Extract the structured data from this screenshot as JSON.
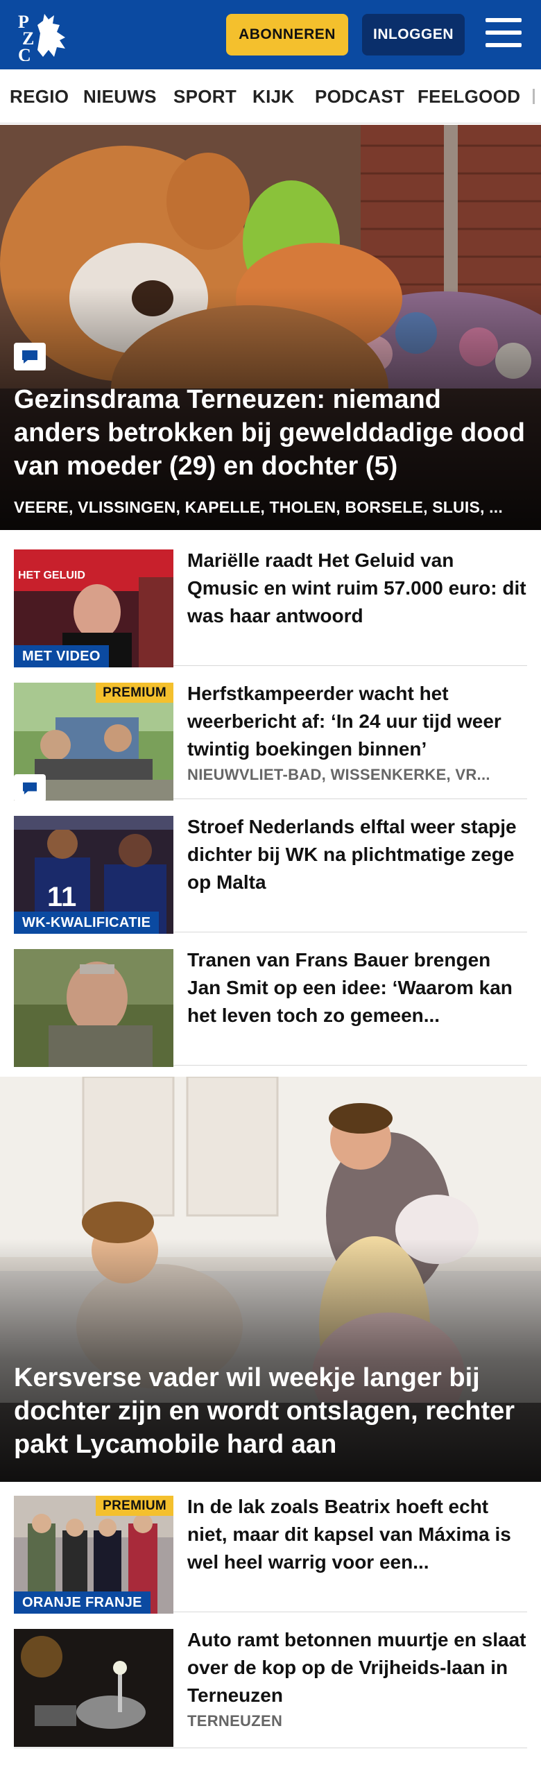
{
  "header": {
    "logo_text": "PZC",
    "subscribe_label": "ABONNEREN",
    "login_label": "INLOGGEN",
    "menu_icon": "hamburger-menu-icon",
    "brand_color": "#0b4aa1",
    "accent_color": "#f4c02d"
  },
  "nav": {
    "items": [
      "REGIO",
      "NIEUWS",
      "SPORT",
      "KIJK",
      "PODCAST",
      "FEELGOOD"
    ]
  },
  "hero1": {
    "title": "Gezinsdrama Terneuzen: niemand anders betrokken bij gewelddadige dood van moeder (29) en dochter (5)",
    "locations": "VEERE, VLISSINGEN, KAPELLE, THOLEN, BORSELE, SLUIS, ...",
    "icon": "comment-icon"
  },
  "articles": [
    {
      "title": "Mariëlle raadt Het Geluid van Qmusic en wint ruim 57.000 euro: dit was haar antwoord",
      "tag": "MET VIDEO"
    },
    {
      "title": "Herfstkampeerder wacht het weerbericht af: ‘In 24 uur tijd weer twintig boekingen binnen’",
      "premium": "PREMIUM",
      "locations": "NIEUWVLIET-BAD, WISSENKERKE, VR..."
    },
    {
      "title": "Stroef Nederlands elftal weer stapje dichter bij WK na plichtmatige zege op Malta",
      "tag": "WK-KWALIFICATIE"
    },
    {
      "title": "Tranen van Frans Bauer brengen Jan Smit op een idee: ‘Waarom kan het leven toch zo gemeen..."
    }
  ],
  "hero2": {
    "title": "Kersverse vader wil weekje langer bij dochter zijn en wordt ontslagen, rechter pakt Lycamobile hard aan"
  },
  "articles2": [
    {
      "title": "In de lak zoals Beatrix hoeft echt niet, maar dit kapsel van Máxima is wel heel warrig voor een...",
      "premium": "PREMIUM",
      "tag": "ORANJE FRANJE"
    },
    {
      "title": "Auto ramt betonnen muurtje en slaat over de kop op de Vrijheids-laan in Terneuzen",
      "locations": "TERNEUZEN"
    }
  ]
}
